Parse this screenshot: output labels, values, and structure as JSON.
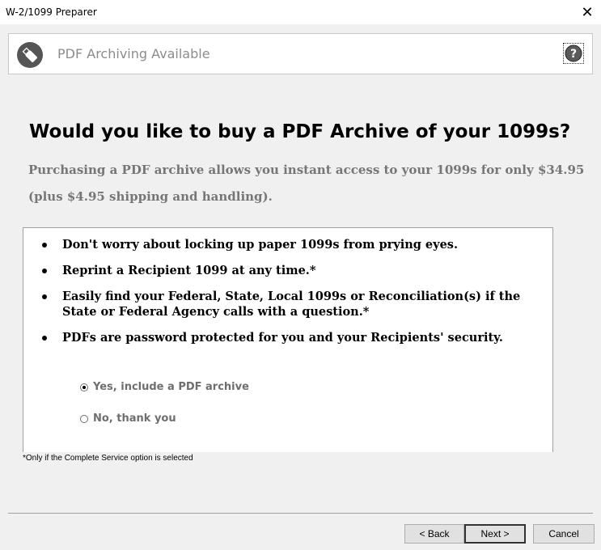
{
  "window": {
    "title": "W-2/1099 Preparer",
    "close_glyph": "✕"
  },
  "banner": {
    "title": "PDF Archiving Available",
    "icon": "usb-drive-icon",
    "help_icon": "help-icon"
  },
  "main": {
    "headline": "Would you like to buy a PDF Archive of your 1099s?",
    "subtext": "Purchasing a PDF archive allows you instant access to your 1099s for only $34.95 (plus $4.95 shipping and handling).",
    "bullets": [
      "Don't worry about locking up paper 1099s from prying eyes.",
      "Reprint a Recipient 1099 at any time.*",
      "Easily find your Federal, State, Local 1099s or Reconciliation(s) if the State or Federal Agency calls with a question.*",
      "PDFs are password protected for you and your Recipients' security."
    ],
    "options": [
      {
        "label": "Yes, include a PDF archive",
        "selected": true
      },
      {
        "label": "No, thank you",
        "selected": false
      }
    ],
    "footnote": "*Only if the Complete Service option is selected"
  },
  "footer": {
    "back_label": "< Back",
    "next_label": "Next >",
    "cancel_label": "Cancel"
  }
}
